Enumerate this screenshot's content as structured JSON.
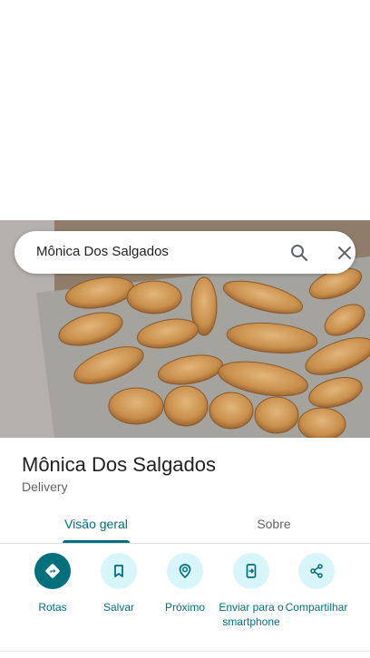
{
  "search": {
    "query": "Mônica Dos Salgados"
  },
  "place": {
    "name": "Mônica Dos Salgados",
    "category": "Delivery"
  },
  "tabs": [
    {
      "label": "Visão geral",
      "selected": true
    },
    {
      "label": "Sobre",
      "selected": false
    }
  ],
  "actions": [
    {
      "label": "Rotas",
      "icon": "directions-icon"
    },
    {
      "label": "Salvar",
      "icon": "bookmark-icon"
    },
    {
      "label": "Próximo",
      "icon": "nearby-icon"
    },
    {
      "label": "Enviar para o smartphone",
      "icon": "send-to-phone-icon"
    },
    {
      "label": "Compartilhar",
      "icon": "share-icon"
    }
  ],
  "colors": {
    "accent": "#00707d",
    "action_bg": "#d8f5fa",
    "text": "#202124",
    "secondary": "#5f6368"
  }
}
